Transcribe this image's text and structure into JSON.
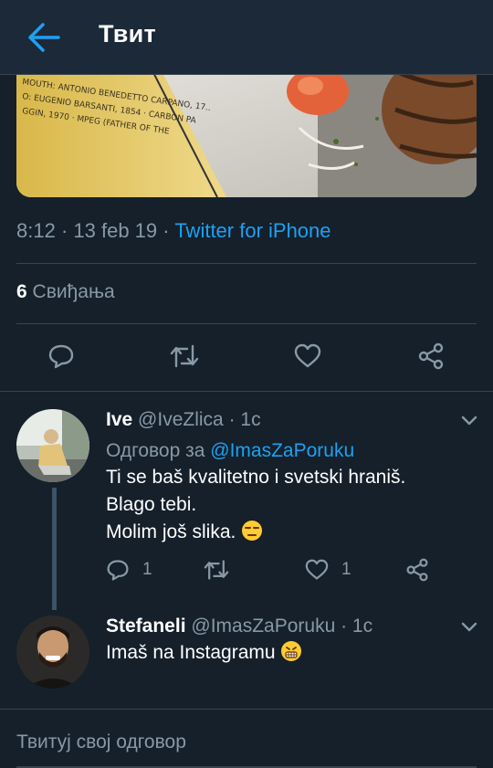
{
  "header": {
    "title": "Твит",
    "back_icon": "arrow-left-icon"
  },
  "tweet": {
    "time": "8:12",
    "date": "13 feb 19",
    "source": "Twitter for iPhone",
    "likes_count": "6",
    "likes_label": "Свиђања"
  },
  "replies": [
    {
      "name": "Ive",
      "handle": "@IveZlica",
      "time": "1с",
      "reply_to_label": "Одговор за",
      "reply_to_handle": "@ImasZaPoruku",
      "lines": [
        "Ti se baš kvalitetno i svetski hraniš.",
        "Blago tebi.",
        "Molim još slika."
      ],
      "emoji": "unamused-face",
      "reply_count": "1",
      "like_count": "1"
    },
    {
      "name": "Stefaneli",
      "handle": "@ImasZaPoruku",
      "time": "1с",
      "text": "Imaš na Instagramu",
      "emoji": "grimacing-face"
    }
  ],
  "compose": {
    "placeholder": "Твитуј свој одговор"
  },
  "colors": {
    "background": "#15202b",
    "header": "#1c2938",
    "accent": "#1da1f2",
    "muted": "#8899a6",
    "border": "#38444d"
  }
}
